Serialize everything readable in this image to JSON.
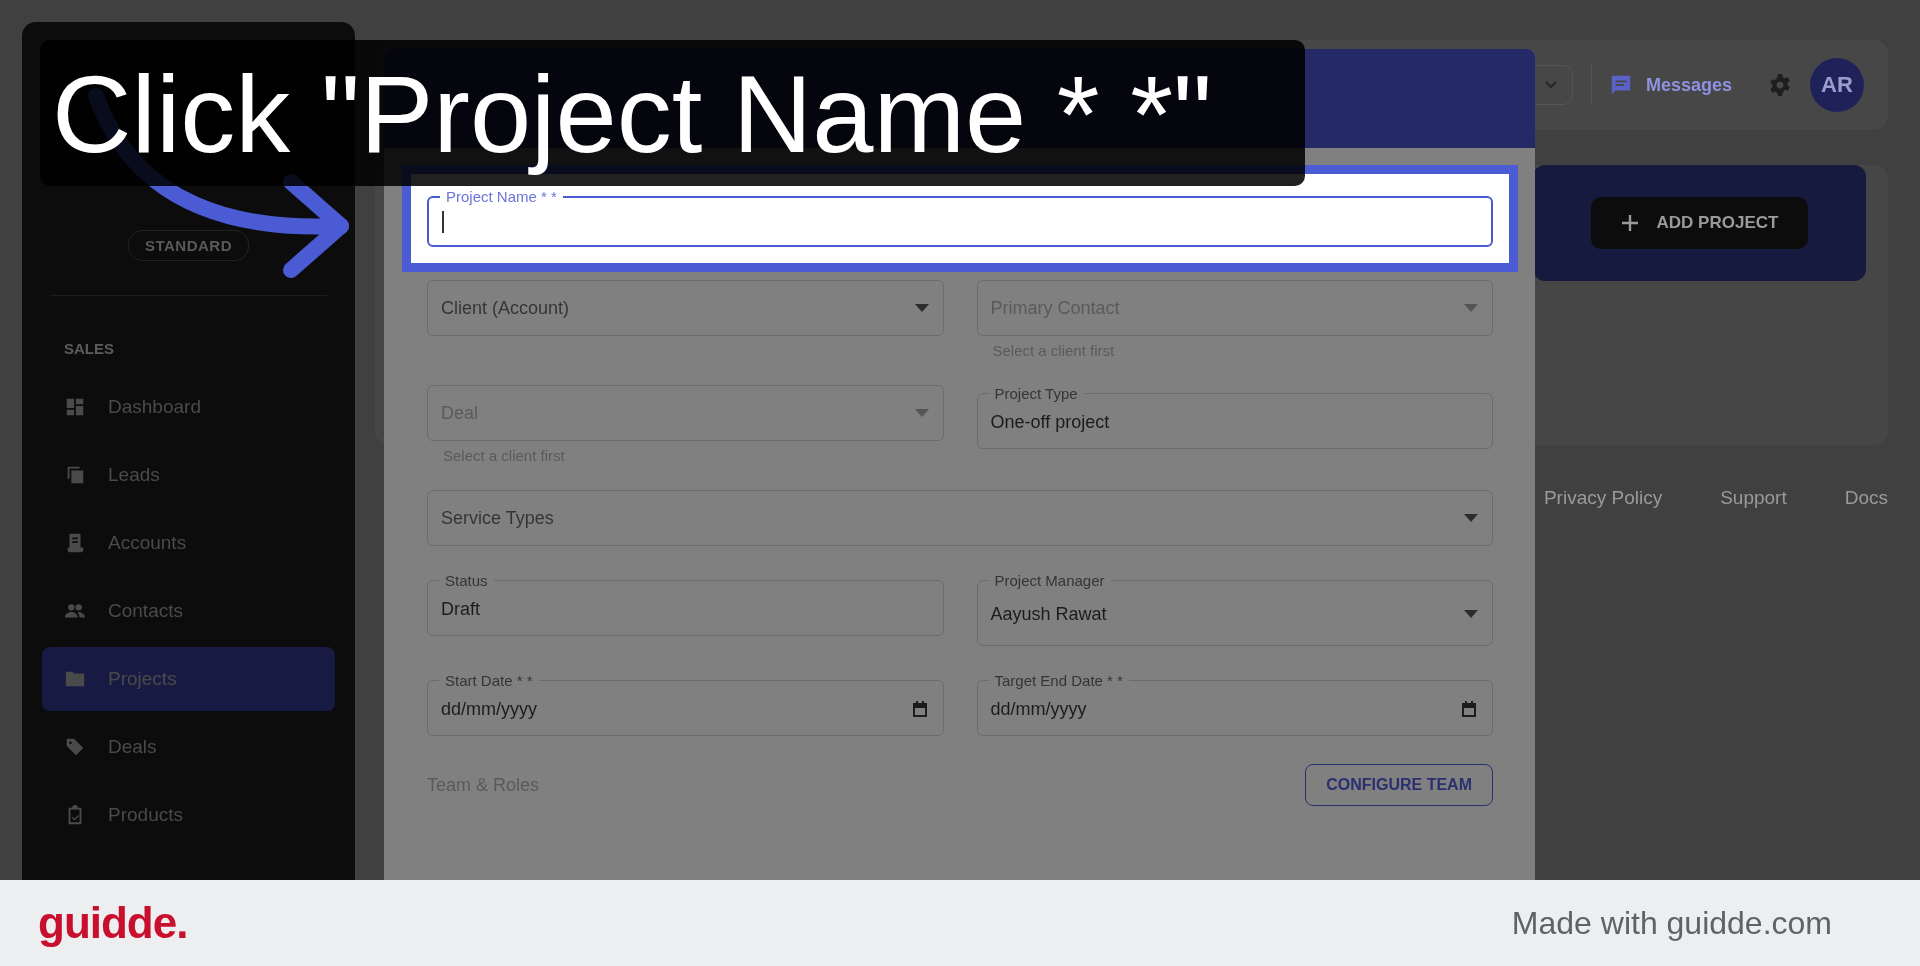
{
  "caption": "Click \"Project Name * *\"",
  "sidebar": {
    "badge": "STANDARD",
    "section": "SALES",
    "items": [
      {
        "label": "Dashboard",
        "selected": false
      },
      {
        "label": "Leads",
        "selected": false
      },
      {
        "label": "Accounts",
        "selected": false
      },
      {
        "label": "Contacts",
        "selected": false
      },
      {
        "label": "Projects",
        "selected": true
      },
      {
        "label": "Deals",
        "selected": false
      },
      {
        "label": "Products",
        "selected": false
      }
    ]
  },
  "topbar": {
    "messages": "Messages",
    "avatar": "AR"
  },
  "banner": {
    "button": "ADD PROJECT"
  },
  "footer_links": [
    "Privacy Policy",
    "Support",
    "Docs"
  ],
  "dialog": {
    "rows": [
      {
        "fields": [
          {
            "kind": "text",
            "label": "Project Name * *",
            "focused": true
          }
        ]
      },
      {
        "fields": [
          {
            "kind": "select",
            "label": "Client (Account)"
          },
          {
            "kind": "select",
            "label": "Primary Contact",
            "disabled": true,
            "helper": "Select a client first"
          }
        ]
      },
      {
        "fields": [
          {
            "kind": "select",
            "label": "Deal",
            "disabled": true,
            "helper": "Select a client first"
          },
          {
            "kind": "text",
            "label": "Project Type",
            "value": "One-off project"
          }
        ]
      },
      {
        "fields": [
          {
            "kind": "select",
            "label": "Service Types"
          }
        ]
      },
      {
        "fields": [
          {
            "kind": "text",
            "label": "Status",
            "value": "Draft"
          },
          {
            "kind": "select",
            "label": "Project Manager",
            "value": "Aayush Rawat"
          }
        ]
      },
      {
        "fields": [
          {
            "kind": "date",
            "label": "Start Date * *",
            "value": "dd/mm/yyyy"
          },
          {
            "kind": "date",
            "label": "Target End Date * *",
            "value": "dd/mm/yyyy"
          }
        ]
      }
    ],
    "section": "Team & Roles",
    "configure_button": "CONFIGURE TEAM"
  },
  "branding": {
    "logo": "guidde.",
    "text": "Made with guidde.com"
  }
}
